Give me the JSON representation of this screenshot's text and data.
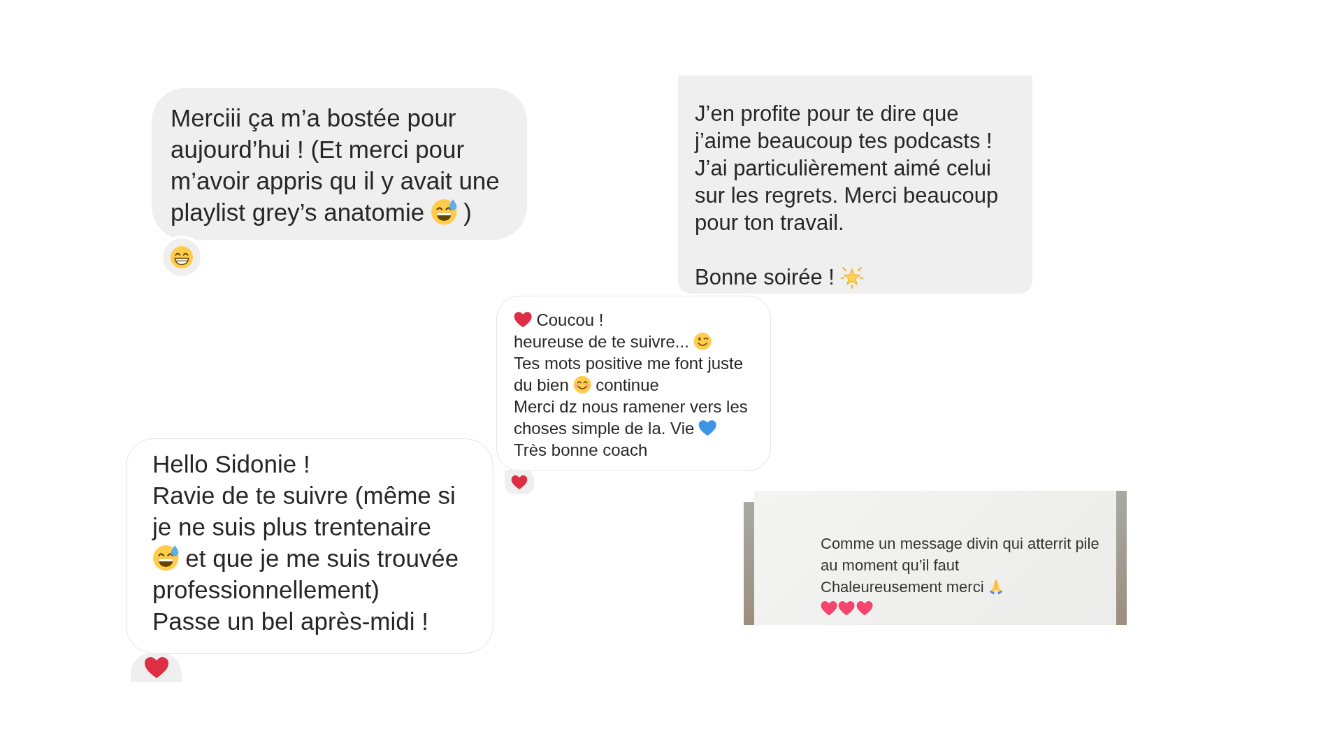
{
  "messages": [
    {
      "kind": "filled",
      "paragraphs": [
        {
          "lines": [
            {
              "parts": [
                {
                  "kind": "text",
                  "text": "Merciii ça m’a bostée pour"
                }
              ]
            },
            {
              "parts": [
                {
                  "kind": "text",
                  "text": "aujourd’hui ! (Et merci pour"
                }
              ]
            },
            {
              "parts": [
                {
                  "kind": "text",
                  "text": "m’avoir appris qu il y avait une"
                }
              ]
            },
            {
              "parts": [
                {
                  "kind": "text",
                  "text": "playlist grey’s anatomie"
                },
                {
                  "kind": "sweatsmile"
                },
                {
                  "kind": "text",
                  "text": ")"
                }
              ]
            }
          ]
        }
      ],
      "reaction": {
        "kind": "grin"
      }
    },
    {
      "kind": "filled",
      "paragraphs": [
        {
          "lines": [
            {
              "parts": [
                {
                  "kind": "text",
                  "text": "J’en profite pour te dire que"
                }
              ]
            },
            {
              "parts": [
                {
                  "kind": "text",
                  "text": "j’aime beaucoup tes podcasts !"
                }
              ]
            },
            {
              "parts": [
                {
                  "kind": "text",
                  "text": "J’ai particulièrement aimé celui"
                }
              ]
            },
            {
              "parts": [
                {
                  "kind": "text",
                  "text": "sur les regrets. Merci beaucoup"
                }
              ]
            },
            {
              "parts": [
                {
                  "kind": "text",
                  "text": "pour ton travail."
                }
              ]
            }
          ]
        },
        {
          "lines": [
            {
              "parts": [
                {
                  "kind": "text",
                  "text": "Bonne soirée !"
                },
                {
                  "kind": "star"
                }
              ]
            }
          ]
        }
      ]
    },
    {
      "kind": "outlined",
      "paragraphs": [
        {
          "lines": [
            {
              "parts": [
                {
                  "kind": "heart"
                },
                {
                  "kind": "text",
                  "text": "Coucou !"
                }
              ]
            },
            {
              "parts": [
                {
                  "kind": "text",
                  "text": "heureuse de te suivre..."
                },
                {
                  "kind": "wink"
                }
              ]
            },
            {
              "parts": [
                {
                  "kind": "text",
                  "text": "Tes mots positive me font juste"
                }
              ]
            },
            {
              "parts": [
                {
                  "kind": "text",
                  "text": "du bien"
                },
                {
                  "kind": "blush"
                },
                {
                  "kind": "text",
                  "text": "continue"
                }
              ]
            },
            {
              "parts": [
                {
                  "kind": "text",
                  "text": "Merci dz nous ramener vers les"
                }
              ]
            },
            {
              "parts": [
                {
                  "kind": "text",
                  "text": "choses simple de la. Vie"
                },
                {
                  "kind": "blueheart"
                }
              ]
            },
            {
              "parts": [
                {
                  "kind": "text",
                  "text": "Très bonne coach"
                }
              ]
            }
          ]
        }
      ],
      "reaction": {
        "kind": "heart"
      }
    },
    {
      "kind": "outlined",
      "paragraphs": [
        {
          "lines": [
            {
              "parts": [
                {
                  "kind": "text",
                  "text": "Hello Sidonie !"
                }
              ]
            },
            {
              "parts": [
                {
                  "kind": "text",
                  "text": "Ravie de te suivre (même si"
                }
              ]
            },
            {
              "parts": [
                {
                  "kind": "text",
                  "text": "je ne suis plus trentenaire"
                }
              ]
            },
            {
              "parts": [
                {
                  "kind": "sweatsmile"
                },
                {
                  "kind": "text",
                  "text": "et que je me suis trouvée"
                }
              ]
            },
            {
              "parts": [
                {
                  "kind": "text",
                  "text": "professionnellement)"
                }
              ]
            },
            {
              "parts": [
                {
                  "kind": "text",
                  "text": "Passe un bel après-midi !"
                }
              ]
            }
          ]
        }
      ],
      "reaction": {
        "kind": "heart"
      }
    },
    {
      "kind": "screenshot",
      "paragraphs": [
        {
          "lines": [
            {
              "parts": [
                {
                  "kind": "text",
                  "text": "Comme un message divin qui atterrit pile"
                }
              ]
            },
            {
              "parts": [
                {
                  "kind": "text",
                  "text": "au moment qu’il faut"
                }
              ]
            },
            {
              "parts": [
                {
                  "kind": "text",
                  "text": "Chaleureusement merci"
                },
                {
                  "kind": "pray"
                }
              ]
            },
            {
              "parts": [
                {
                  "kind": "pinkheart"
                },
                {
                  "kind": "pinkheart"
                },
                {
                  "kind": "pinkheart"
                }
              ]
            }
          ]
        }
      ]
    }
  ]
}
